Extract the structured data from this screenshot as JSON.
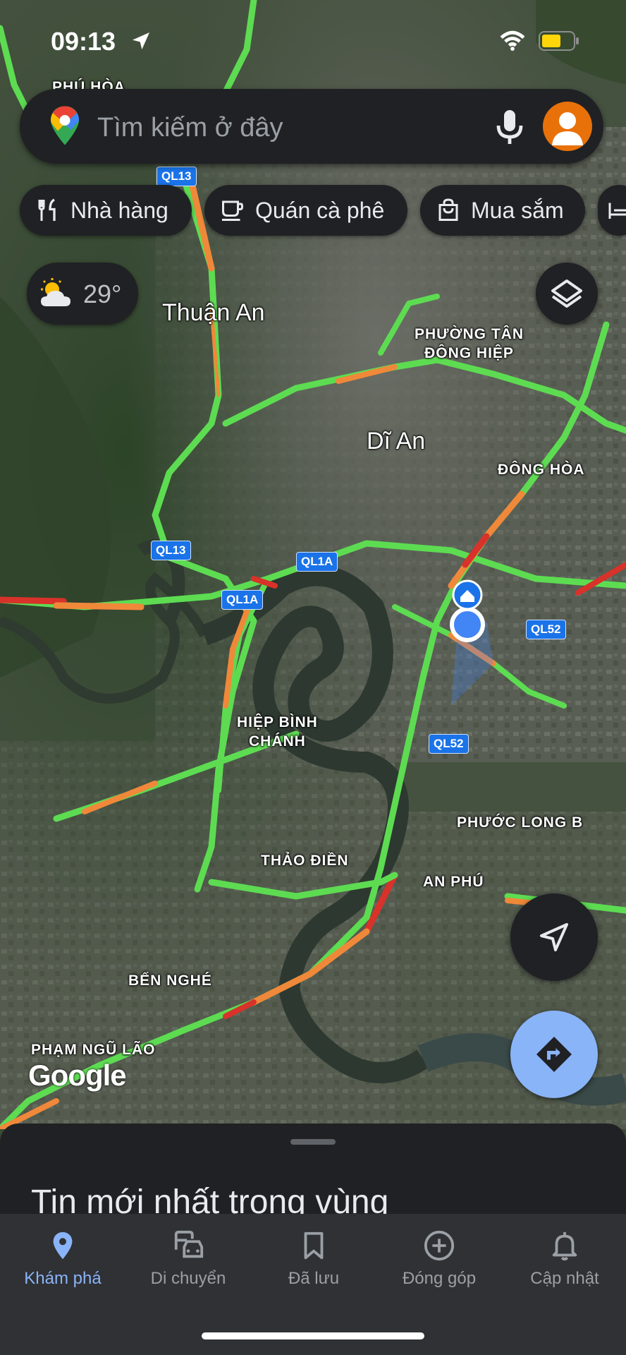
{
  "status_bar": {
    "time": "09:13"
  },
  "search": {
    "placeholder": "Tìm kiếm ở đây"
  },
  "chips": [
    {
      "label": "Nhà hàng",
      "icon": "restaurant-icon"
    },
    {
      "label": "Quán cà phê",
      "icon": "coffee-icon"
    },
    {
      "label": "Mua sắm",
      "icon": "shopping-bag-icon"
    }
  ],
  "weather": {
    "temp": "29°",
    "icon": "partly-cloudy-icon"
  },
  "map": {
    "labels": {
      "phu_hoa": "PHÚ HÒA",
      "thuan_an": "Thuận An",
      "phuong_tan_dong_hiep_1": "PHƯỜNG TÂN",
      "phuong_tan_dong_hiep_2": "ĐÔNG HIỆP",
      "di_an": "Dĩ An",
      "dong_hoa": "ĐÔNG HÒA",
      "hiep_binh_chanh_1": "HIỆP BÌNH",
      "hiep_binh_chanh_2": "CHÁNH",
      "phuoc_long_b": "PHƯỚC LONG B",
      "thao_dien": "THẢO ĐIỀN",
      "an_phu": "AN PHÚ",
      "ben_nghe": "BẾN NGHÉ",
      "pham_ngu_lao": "PHẠM NGŨ LÃO"
    },
    "shields": {
      "ql13_top": "QL13",
      "ql13_mid": "QL13",
      "ql1a_a": "QL1A",
      "ql1a_b": "QL1A",
      "ql52_a": "QL52",
      "ql52_b": "QL52"
    },
    "google": "Google",
    "colors": {
      "traffic_green": "#5ddc52",
      "traffic_orange": "#f0883a",
      "traffic_red": "#d8322a",
      "location_blue": "#4285f4"
    }
  },
  "sheet": {
    "title": "Tin mới nhất trong vùng"
  },
  "nav": [
    {
      "label": "Khám phá",
      "icon": "explore-pin-icon",
      "active": true
    },
    {
      "label": "Di chuyển",
      "icon": "commute-icon",
      "active": false
    },
    {
      "label": "Đã lưu",
      "icon": "bookmark-icon",
      "active": false
    },
    {
      "label": "Đóng góp",
      "icon": "add-circle-icon",
      "active": false
    },
    {
      "label": "Cập nhật",
      "icon": "bell-icon",
      "active": false
    }
  ]
}
